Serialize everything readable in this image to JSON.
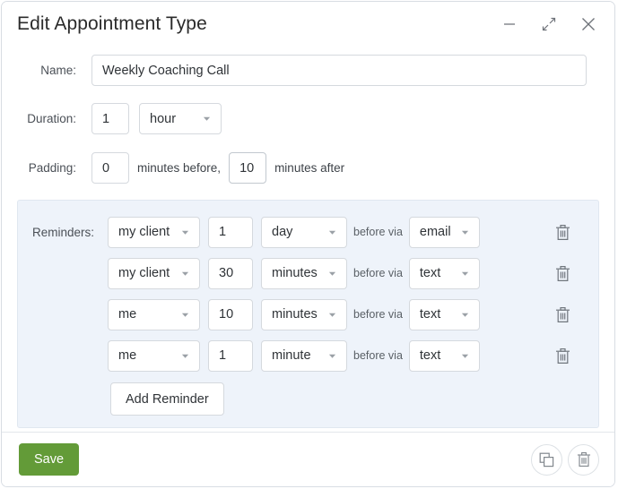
{
  "window": {
    "title": "Edit Appointment Type",
    "buttons": [
      {
        "name": "minimize",
        "icon": "minimize-icon",
        "label": "Minimize"
      },
      {
        "name": "collapse",
        "icon": "collapse-icon",
        "label": "Collapse"
      },
      {
        "name": "close",
        "icon": "close-icon",
        "label": "Close"
      }
    ]
  },
  "form": {
    "name": {
      "label": "Name:",
      "value": "Weekly Coaching Call",
      "placeholder": ""
    },
    "duration": {
      "label": "Duration:",
      "amount": "1",
      "unit": "hour"
    },
    "padding": {
      "label": "Padding:",
      "before_value": "0",
      "middle_text": "minutes before,",
      "after_value": "10",
      "after_text": "minutes after"
    },
    "reminders": {
      "label": "Reminders:",
      "middle_text": "before via",
      "add_label": "Add Reminder",
      "delete_icon": "trash-icon",
      "rows": [
        {
          "who": "my client",
          "amount": "1",
          "unit": "day",
          "via": "email"
        },
        {
          "who": "my client",
          "amount": "30",
          "unit": "minutes",
          "via": "text"
        },
        {
          "who": "me",
          "amount": "10",
          "unit": "minutes",
          "via": "text"
        },
        {
          "who": "me",
          "amount": "1",
          "unit": "minute",
          "via": "text"
        }
      ]
    }
  },
  "footer": {
    "save_label": "Save",
    "duplicate_icon": "copy-icon",
    "delete_icon": "trash-icon"
  },
  "colors": {
    "accent_green": "#639b38",
    "panel_bg": "#eef3fa",
    "border": "#d5d9de",
    "text": "#2f3337",
    "label_text": "#4b5057"
  }
}
